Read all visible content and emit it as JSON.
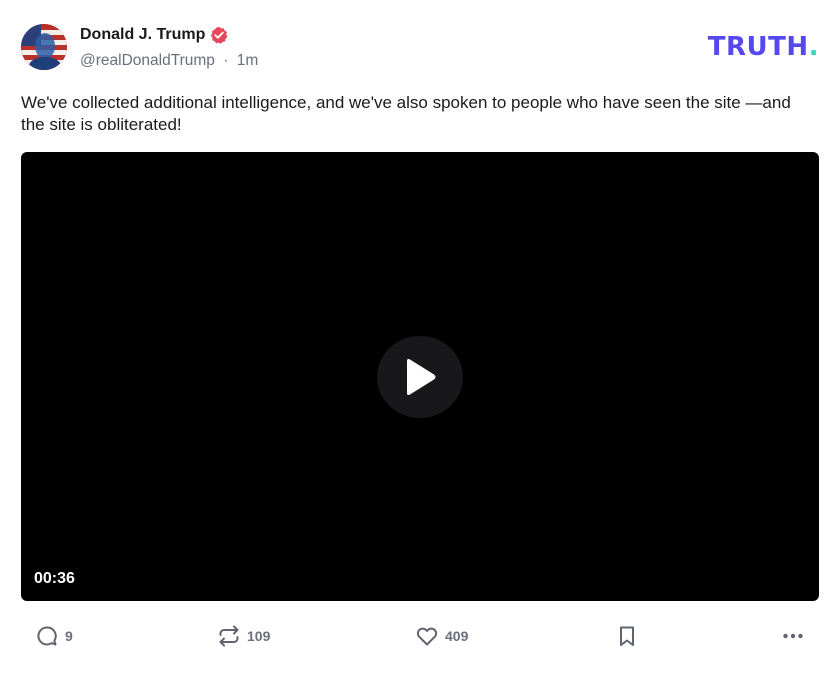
{
  "post": {
    "author_name": "Donald J. Trump",
    "handle": "@realDonaldTrump",
    "separator": "·",
    "time_ago": "1m",
    "text": "We've collected additional intelligence, and we've also spoken to people who have seen the site —and the site is obliterated!"
  },
  "logo": {
    "text": "TRUTH",
    "dot": "."
  },
  "video": {
    "duration": "00:36"
  },
  "actions": {
    "replies": "9",
    "retruths": "109",
    "likes": "409"
  },
  "icons": {
    "verified": "verified-badge-icon",
    "reply": "comment-bubble-icon",
    "retruth": "repost-arrows-icon",
    "like": "heart-icon",
    "bookmark": "bookmark-icon",
    "more": "more-dots-icon",
    "play": "play-icon"
  },
  "colors": {
    "brand": "#5448ee",
    "brand_dot": "#38d6c4",
    "verified": "#e5485c",
    "muted": "#6b6f7a"
  }
}
